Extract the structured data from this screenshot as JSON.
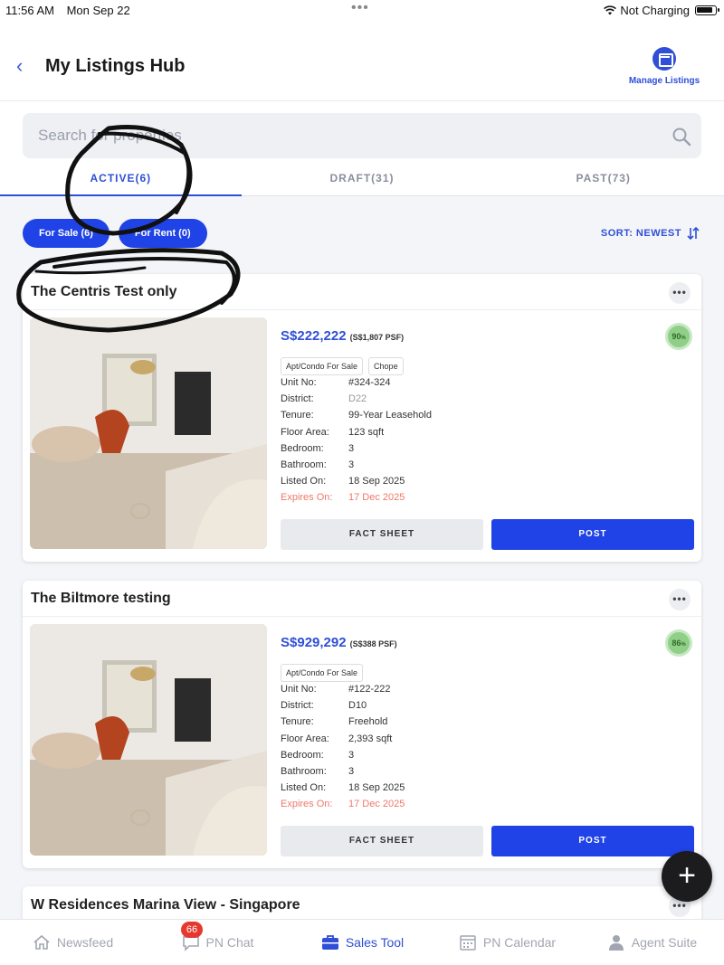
{
  "status_bar": {
    "time": "11:56 AM",
    "date": "Mon Sep 22",
    "charging": "Not Charging"
  },
  "header": {
    "title": "My Listings Hub",
    "manage_label": "Manage Listings"
  },
  "search": {
    "placeholder": "Search for properties"
  },
  "tabs": [
    {
      "label": "ACTIVE(6)",
      "active": true
    },
    {
      "label": "DRAFT(31)",
      "active": false
    },
    {
      "label": "PAST(73)",
      "active": false
    }
  ],
  "filters": [
    {
      "label": "For Sale (6)"
    },
    {
      "label": "For Rent (0)"
    }
  ],
  "sort_label": "SORT: NEWEST",
  "listings": [
    {
      "title": "The Centris Test only",
      "price": "S$222,222",
      "psf": "(S$1,807 PSF)",
      "score": "90",
      "type": "Apt/Condo For Sale",
      "tag": "Chope",
      "fields": [
        {
          "k": "Unit No:",
          "v": "#324-324"
        },
        {
          "k": "District:",
          "v": "D22"
        },
        {
          "k": "Tenure:",
          "v": "99-Year Leasehold"
        },
        {
          "k": "Floor Area:",
          "v": "123 sqft"
        },
        {
          "k": "Bedroom:",
          "v": "3"
        },
        {
          "k": "Bathroom:",
          "v": "3"
        },
        {
          "k": "Listed On:",
          "v": "18 Sep 2025"
        },
        {
          "k": "Expires On:",
          "v": "17 Dec 2025"
        }
      ],
      "fact_label": "FACT SHEET",
      "post_label": "POST"
    },
    {
      "title": "The Biltmore testing",
      "price": "S$929,292",
      "psf": "(S$388 PSF)",
      "score": "86",
      "type": "Apt/Condo For Sale",
      "tag": "",
      "fields": [
        {
          "k": "Unit No:",
          "v": "#122-222"
        },
        {
          "k": "District:",
          "v": "D10"
        },
        {
          "k": "Tenure:",
          "v": "Freehold"
        },
        {
          "k": "Floor Area:",
          "v": "2,393 sqft"
        },
        {
          "k": "Bedroom:",
          "v": "3"
        },
        {
          "k": "Bathroom:",
          "v": "3"
        },
        {
          "k": "Listed On:",
          "v": "18 Sep 2025"
        },
        {
          "k": "Expires On:",
          "v": "17 Dec 2025"
        }
      ],
      "fact_label": "FACT SHEET",
      "post_label": "POST"
    },
    {
      "title": "W Residences Marina View - Singapore"
    }
  ],
  "fab_label": "+",
  "bottom_nav": [
    {
      "label": "Newsfeed",
      "icon": "home-icon"
    },
    {
      "label": "PN Chat",
      "icon": "chat-icon",
      "badge": "66"
    },
    {
      "label": "Sales Tool",
      "icon": "briefcase-icon",
      "active": true
    },
    {
      "label": "PN Calendar",
      "icon": "calendar-icon"
    },
    {
      "label": "Agent Suite",
      "icon": "person-icon"
    }
  ],
  "colors": {
    "accent": "#2f4fd6",
    "primary_button": "#1f43e6",
    "expires": "#f0776a",
    "score_green": "#8fcf87",
    "badge_red": "#e5392f"
  }
}
